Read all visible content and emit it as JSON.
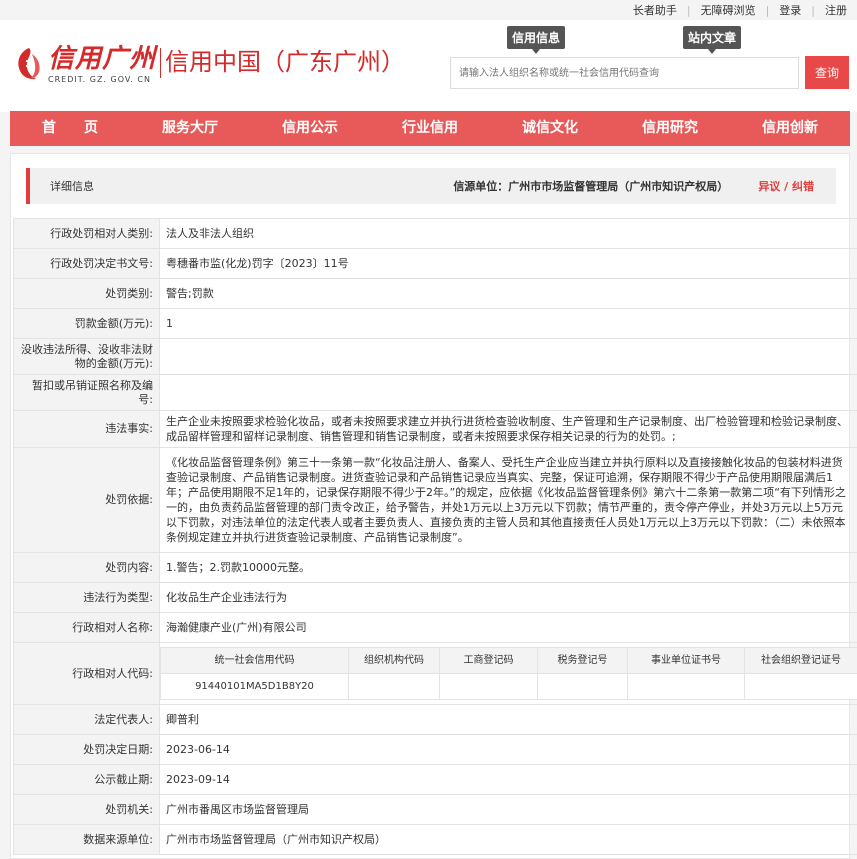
{
  "toplinks": [
    "长者助手",
    "无障碍浏览",
    "登录",
    "注册"
  ],
  "logo": {
    "brand": "信用广州",
    "domain_text": "CREDIT. GZ. GOV. CN",
    "subtitle": "信用中国（广东广州）"
  },
  "search": {
    "tabs": [
      "信用信息",
      "站内文章"
    ],
    "placeholder": "请输入法人组织名称或统一社会信用代码查询",
    "button": "查询"
  },
  "nav": [
    "首　　页",
    "服务大厅",
    "信用公示",
    "行业信用",
    "诚信文化",
    "信用研究",
    "信用创新"
  ],
  "detail": {
    "title": "详细信息",
    "source": "信源单位：广州市市场监督管理局（广州市知识产权局）",
    "dispute": "异议 / 纠错"
  },
  "rows": {
    "r1": {
      "label": "行政处罚相对人类别:",
      "value": "法人及非法人组织"
    },
    "r2": {
      "label": "行政处罚决定书文号:",
      "value": "粤穗番市监(化龙)罚字〔2023〕11号"
    },
    "r3": {
      "label": "处罚类别:",
      "value": "警告;罚款"
    },
    "r4": {
      "label": "罚款金额(万元):",
      "value": "1"
    },
    "r5": {
      "label": "没收违法所得、没收非法财物的金额(万元):",
      "value": ""
    },
    "r6": {
      "label": "暂扣或吊销证照名称及编号:",
      "value": ""
    },
    "r7": {
      "label": "违法事实:",
      "value": "生产企业未按照要求检验化妆品，或者未按照要求建立并执行进货检查验收制度、生产管理和生产记录制度、出厂检验管理和检验记录制度、成品留样管理和留样记录制度、销售管理和销售记录制度，或者未按照要求保存相关记录的行为的处罚。;"
    },
    "r8": {
      "label": "处罚依据:",
      "value": "《化妆品监督管理条例》第三十一条第一款“化妆品注册人、备案人、受托生产企业应当建立并执行原料以及直接接触化妆品的包装材料进货查验记录制度、产品销售记录制度。进货查验记录和产品销售记录应当真实、完整，保证可追溯，保存期限不得少于产品使用期限届满后1年；产品使用期限不足1年的，记录保存期限不得少于2年。”的规定，应依据《化妆品监督管理条例》第六十二条第一款第二项“有下列情形之一的，由负责药品监督管理的部门责令改正，给予警告，并处1万元以上3万元以下罚款；情节严重的，责令停产停业，并处3万元以上5万元以下罚款，对违法单位的法定代表人或者主要负责人、直接负责的主管人员和其他直接责任人员处1万元以上3万元以下罚款：（二）未依照本条例规定建立并执行进货查验记录制度、产品销售记录制度”。"
    },
    "r9": {
      "label": "处罚内容:",
      "value": "1.警告；2.罚款10000元整。"
    },
    "r10": {
      "label": "违法行为类型:",
      "value": "化妆品生产企业违法行为"
    },
    "r11": {
      "label": "行政相对人名称:",
      "value": "海瀚健康产业(广州)有限公司"
    },
    "r12": {
      "label": "行政相对人代码:"
    },
    "r13": {
      "label": "法定代表人:",
      "value": "卿普利"
    },
    "r14": {
      "label": "处罚决定日期:",
      "value": "2023-06-14"
    },
    "r15": {
      "label": "公示截止期:",
      "value": "2023-09-14"
    },
    "r16": {
      "label": "处罚机关:",
      "value": "广州市番禺区市场监督管理局"
    },
    "r17": {
      "label": "数据来源单位:",
      "value": "广州市市场监督管理局（广州市知识产权局）"
    }
  },
  "codes": {
    "headers": [
      "统一社会信用代码",
      "组织机构代码",
      "工商登记码",
      "税务登记号",
      "事业单位证书号",
      "社会组织登记证号"
    ],
    "values": [
      "91440101MA5D1B8Y20",
      "",
      "",
      "",
      "",
      ""
    ]
  },
  "colors": {
    "brand_red": "#d42a2a",
    "nav_red": "#e85a5a",
    "button_red": "#e84848"
  }
}
